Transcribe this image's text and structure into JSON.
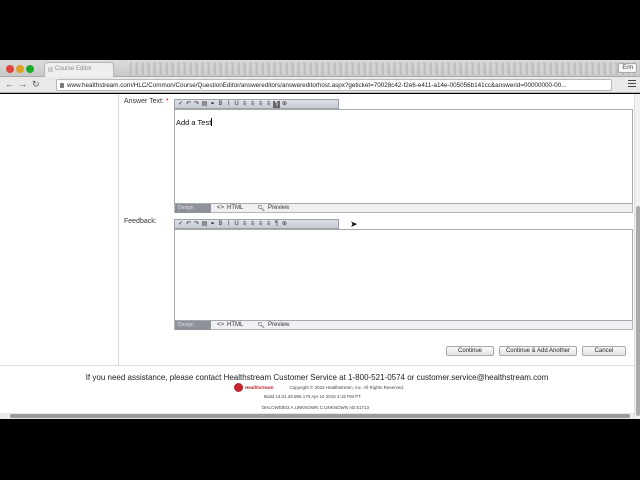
{
  "browser": {
    "tab_title": "Course Editor",
    "user_button": "Erin",
    "url": "www.healthstream.com/HLC/Common/Course/QuestionEditor/answereditors/answereditorhost.aspx?geticket=70028c42-f2e6-e411-a14e-005056b141cc&answerid=00000000-00..."
  },
  "form": {
    "answer_label": "Answer Text:",
    "required_mark": "*",
    "answer_value": "Add a Test",
    "feedback_label": "Feedback:",
    "feedback_value": "",
    "bottom_tabs": {
      "design": "Design",
      "html": "HTML",
      "preview": "Preview"
    }
  },
  "toolbar_icons": [
    "check-spelling-icon",
    "undo-icon",
    "redo-icon",
    "paste-icon",
    "link-icon",
    "bold-icon",
    "italic-icon",
    "underline-icon",
    "align-left-icon",
    "align-center-icon",
    "align-right-icon",
    "justify-icon",
    "format-icon",
    "zoom-icon"
  ],
  "actions": {
    "continue": "Continue",
    "continue_add": "Continue & Add Another",
    "cancel": "Cancel"
  },
  "footer": {
    "help_text": "If you need assistance, please contact Healthstream Customer Service at 1-800-521-0574 or customer.service@healthstream.com",
    "logo_text": "Healthstream",
    "copyright": "Copyright © 2015 Healthstream, Inc. All Rights Reserved.",
    "build": "Build 13.01.28.995.170  Apr 16 2015 3:15 PM PT",
    "server": "DHLCWEB03  A.UNKNOWN  C.UNKNOWN  AD:51713"
  }
}
